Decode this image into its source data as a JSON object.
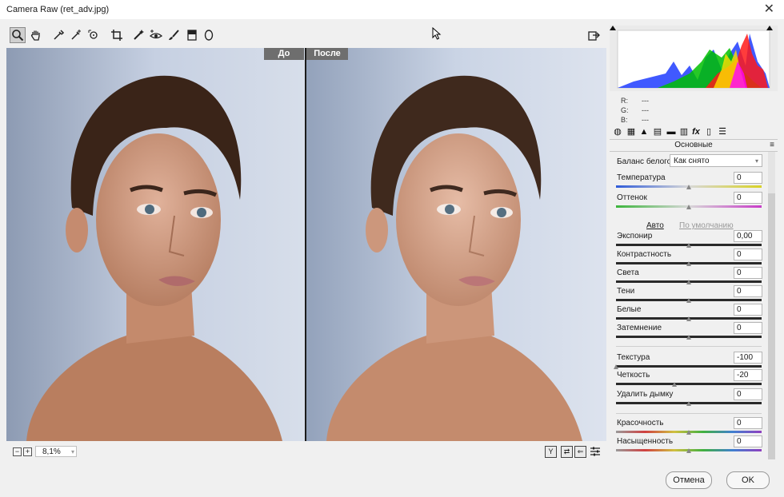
{
  "window": {
    "title": "Camera Raw (ret_adv.jpg)"
  },
  "toolbar": {
    "tools": [
      "zoom-icon",
      "hand-icon",
      "eyedropper-icon",
      "color-sampler-icon",
      "target-adjust-icon",
      "crop-icon",
      "spot-removal-icon",
      "red-eye-icon",
      "adjustment-brush-icon",
      "graduated-filter-icon",
      "radial-filter-icon"
    ],
    "export_icon": "export-icon"
  },
  "viewer": {
    "label_before": "До",
    "label_after": "После",
    "zoom_level": "8,1%"
  },
  "panel": {
    "rgb": {
      "r_label": "R:",
      "g_label": "G:",
      "b_label": "B:",
      "r_val": "---",
      "g_val": "---",
      "b_val": "---"
    },
    "section_title": "Основные",
    "white_balance_label": "Баланс белого:",
    "white_balance_value": "Как снято",
    "auto": "Авто",
    "default": "По умолчанию",
    "controls": [
      {
        "label": "Температура",
        "value": "0",
        "level": 0.5
      },
      {
        "label": "Оттенок",
        "value": "0",
        "level": 0.5
      },
      {
        "label": "Экспонир",
        "value": "0,00",
        "level": 0.5
      },
      {
        "label": "Контрастность",
        "value": "0",
        "level": 0.5
      },
      {
        "label": "Света",
        "value": "0",
        "level": 0.5
      },
      {
        "label": "Тени",
        "value": "0",
        "level": 0.5
      },
      {
        "label": "Белые",
        "value": "0",
        "level": 0.5
      },
      {
        "label": "Затемнение",
        "value": "0",
        "level": 0.5
      },
      {
        "label": "Текстура",
        "value": "-100",
        "level": 0.0
      },
      {
        "label": "Четкость",
        "value": "-20",
        "level": 0.4
      },
      {
        "label": "Удалить дымку",
        "value": "0",
        "level": 0.5
      },
      {
        "label": "Красочность",
        "value": "0",
        "level": 0.5
      },
      {
        "label": "Насыщенность",
        "value": "0",
        "level": 0.5
      }
    ]
  },
  "buttons": {
    "cancel": "Отмена",
    "ok": "OK"
  }
}
